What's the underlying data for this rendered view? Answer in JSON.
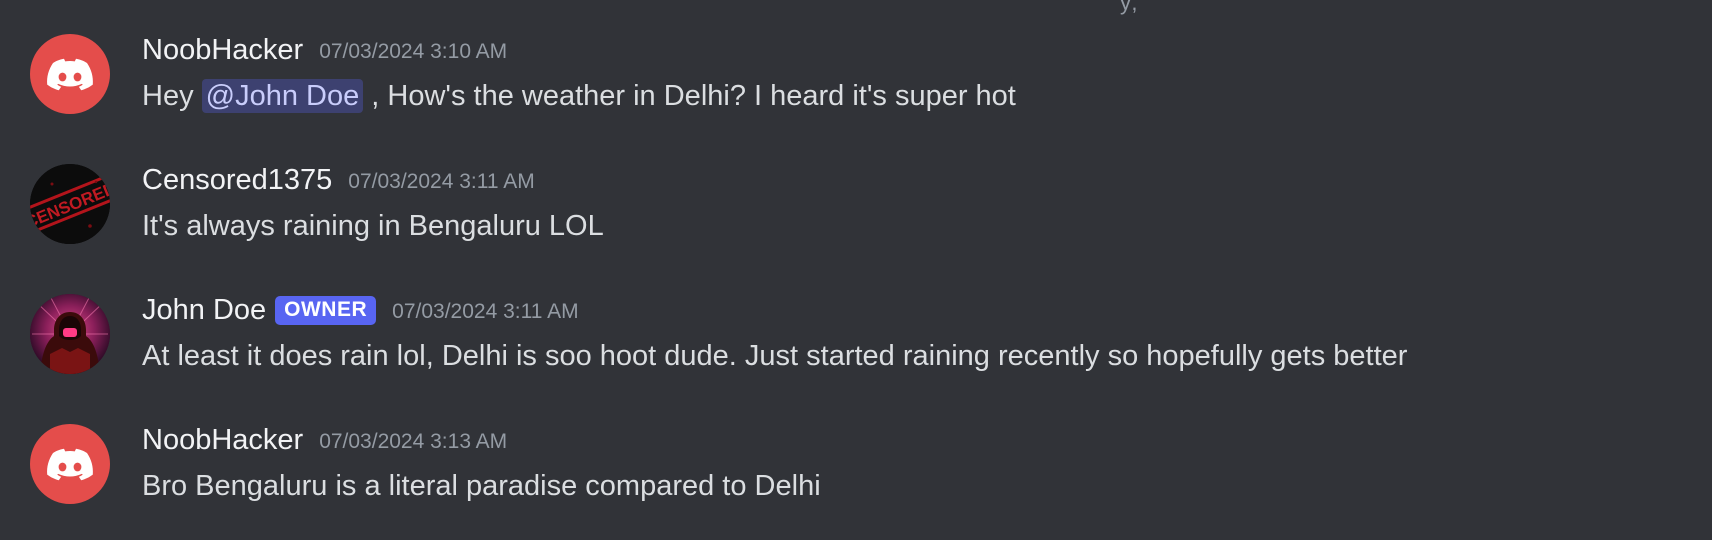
{
  "top_fragment": "y,",
  "messages": [
    {
      "username": "NoobHacker",
      "avatar_icon": "discord-logo-icon",
      "avatar_color": "#e44d4b",
      "timestamp": "07/03/2024 3:10 AM",
      "content_before": "Hey ",
      "mention": "@John Doe",
      "content_after": " , How's the weather in Delhi? I heard it's super hot"
    },
    {
      "username": "Censored1375",
      "avatar_icon": "censored-stamp-icon",
      "avatar_text": "CENSORED",
      "timestamp": "07/03/2024 3:11 AM",
      "content": "It's always raining in Bengaluru LOL"
    },
    {
      "username": "John Doe",
      "badge": "OWNER",
      "avatar_icon": "hooded-figure-icon",
      "timestamp": "07/03/2024 3:11 AM",
      "content": "At least it does rain lol, Delhi is soo hoot dude. Just started raining recently so hopefully gets better"
    },
    {
      "username": "NoobHacker",
      "avatar_icon": "discord-logo-icon",
      "avatar_color": "#e44d4b",
      "timestamp": "07/03/2024 3:13 AM",
      "content": "Bro Bengaluru is a literal paradise compared to Delhi"
    }
  ]
}
